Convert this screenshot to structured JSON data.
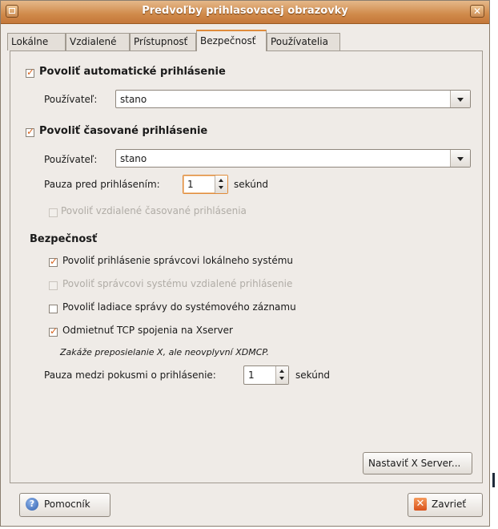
{
  "window": {
    "title": "Predvoľby prihlasovacej obrazovky",
    "close_symbol": "✕"
  },
  "tabs": [
    {
      "label": "Lokálne"
    },
    {
      "label": "Vzdialené"
    },
    {
      "label": "Prístupnosť"
    },
    {
      "label": "Bezpečnosť"
    },
    {
      "label": "Používatelia"
    }
  ],
  "auto_login": {
    "heading": "Povoliť automatické prihlásenie",
    "checked": true,
    "user_label": "Používateľ:",
    "user_value": "stano"
  },
  "timed_login": {
    "heading": "Povoliť časované prihlásenie",
    "checked": true,
    "user_label": "Používateľ:",
    "user_value": "stano",
    "pause_label": "Pauza pred prihlásením:",
    "pause_value": "1",
    "pause_unit": "sekúnd",
    "remote_label": "Povoliť vzdialené časované prihlásenia",
    "remote_checked": false
  },
  "security": {
    "heading": "Bezpečnosť",
    "items": [
      {
        "label": "Povoliť prihlásenie správcovi lokálneho systému",
        "checked": true,
        "enabled": true
      },
      {
        "label": "Povoliť správcovi systému vzdialené prihlásenie",
        "checked": false,
        "enabled": false
      },
      {
        "label": "Povoliť ladiace správy do systémového záznamu",
        "checked": false,
        "enabled": true
      },
      {
        "label": "Odmietnuť TCP spojenia na Xserver",
        "checked": true,
        "enabled": true
      }
    ],
    "note": "Zakáže preposielanie X, ale neovplyvní XDMCP.",
    "retry_label": "Pauza medzi pokusmi o prihlásenie:",
    "retry_value": "1",
    "retry_unit": "sekúnd",
    "configure_button": "Nastaviť X Server..."
  },
  "footer": {
    "help_button": "Pomocník",
    "close_button": "Zavrieť"
  },
  "icons": {
    "help": "help-icon",
    "close": "close-icon",
    "check": "checkmark"
  },
  "colors": {
    "accent": "#e08b3a",
    "titlebar": "#d08a4a",
    "background": "#efebe7"
  }
}
